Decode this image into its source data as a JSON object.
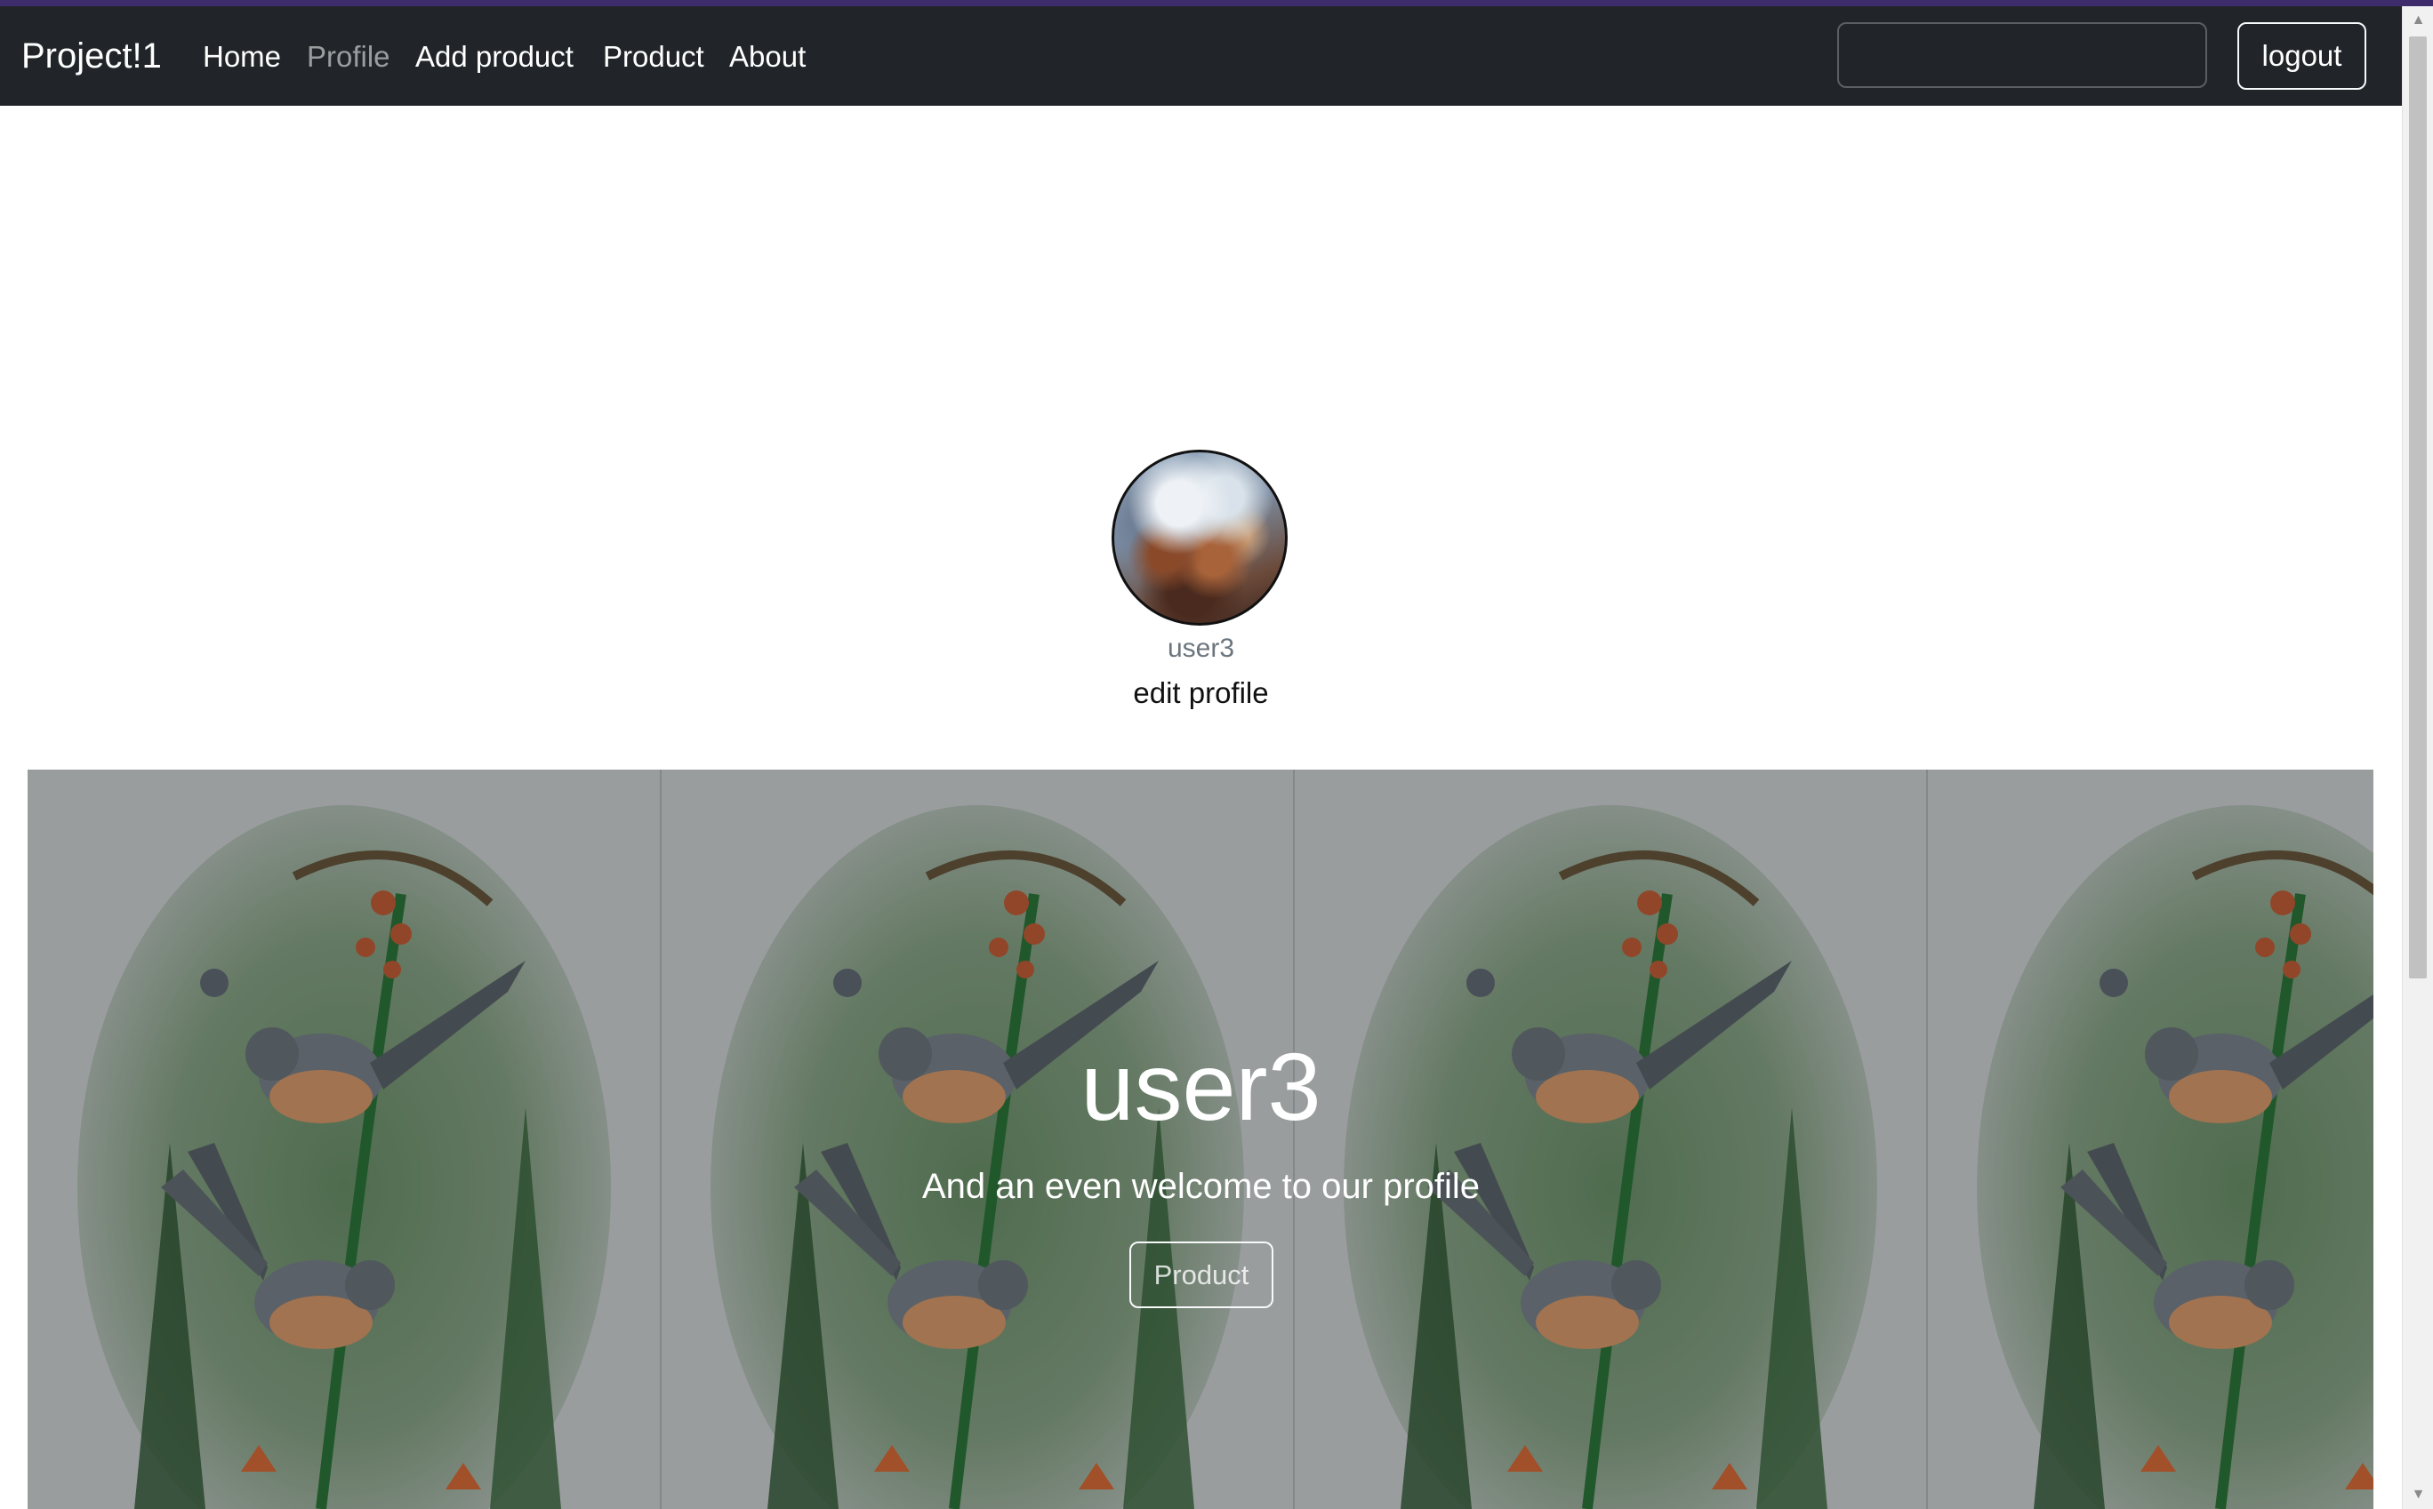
{
  "navbar": {
    "brand": "Project!1",
    "links": [
      {
        "label": "Home",
        "active": false
      },
      {
        "label": "Profile",
        "active": true
      },
      {
        "label": "Add product",
        "active": false
      },
      {
        "label": "Product",
        "active": false
      },
      {
        "label": "About",
        "active": false
      }
    ],
    "search": {
      "value": "",
      "placeholder": ""
    },
    "logout_label": "logout"
  },
  "profile": {
    "username": "user3",
    "edit_label": "edit profile",
    "avatar_icon": "avatar-painting"
  },
  "hero": {
    "title": "user3",
    "subtitle": "And an even welcome to our profile",
    "button_label": "Product",
    "background_icon": "bird-painting-tile"
  },
  "colors": {
    "navbar_bg": "#212529",
    "top_accent": "#3d2b6b",
    "muted_text": "#6c757d",
    "hero_text": "#ffffff"
  }
}
